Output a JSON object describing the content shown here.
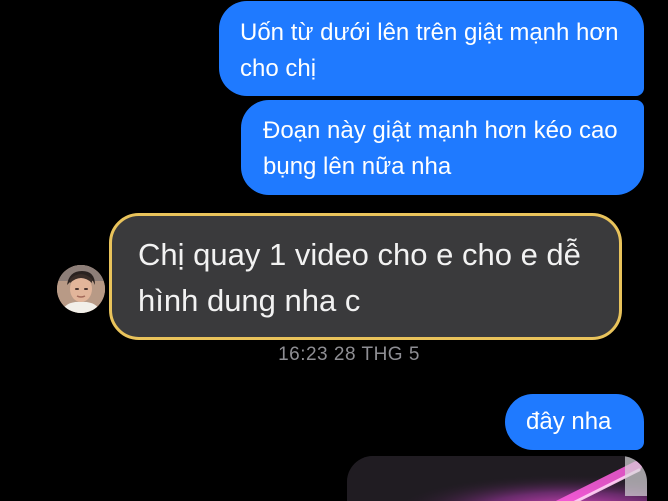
{
  "messages": {
    "sent_1": "Uốn từ dưới lên trên giật mạnh hơn cho chị",
    "sent_2": "Đoạn này giật mạnh hơn kéo cao bụng lên nữa nha",
    "received_1": "Chị quay 1 video cho e cho e dễ hình dung nha c",
    "timestamp": "16:23 28 THG 5",
    "sent_3": "đây nha"
  },
  "colors": {
    "background": "#000000",
    "sent_bubble": "#1f7aff",
    "received_bubble": "#3a3a3c",
    "highlight_border": "#e9c35b",
    "timestamp_text": "#8e8e93"
  },
  "icons": {
    "avatar": "contact-avatar-photo"
  }
}
